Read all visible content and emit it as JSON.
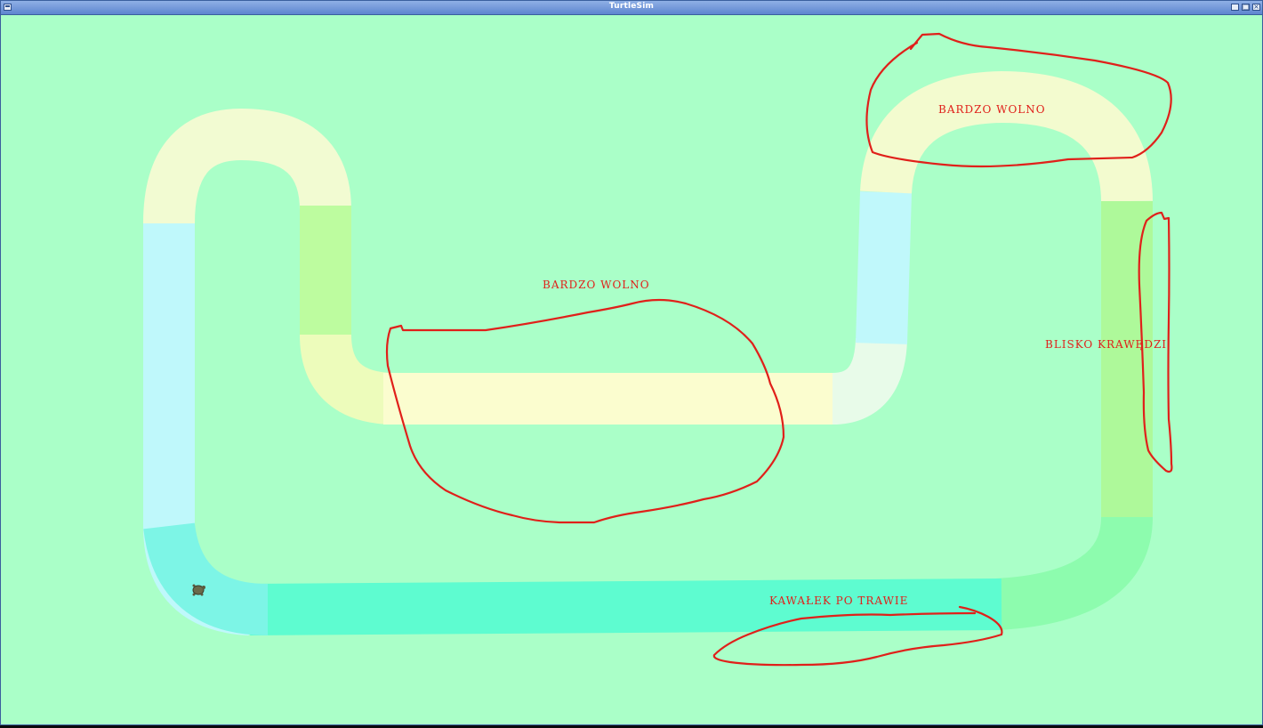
{
  "window": {
    "title": "TurtleSim",
    "controls": [
      "minimize",
      "maximize",
      "close"
    ]
  },
  "colors": {
    "background": "#aaffc8",
    "titlebar": "#5d85cf",
    "annotation": "#e0201a",
    "track_colors": [
      "#fdfdd2",
      "#e4fbee",
      "#c6f8fa",
      "#aff7fb",
      "#7af7e0",
      "#5efcd0",
      "#7dfca8",
      "#aef99a",
      "#eefbab"
    ]
  },
  "annotations": [
    {
      "text": "BARDZO WOLNO"
    },
    {
      "text": "BARDZO WOLNO"
    },
    {
      "text": "BLISKO KRAWĘDZI"
    },
    {
      "text": "KAWAŁEK PO TRAWIE"
    }
  ],
  "icons": {
    "turtle": "turtle-icon"
  }
}
